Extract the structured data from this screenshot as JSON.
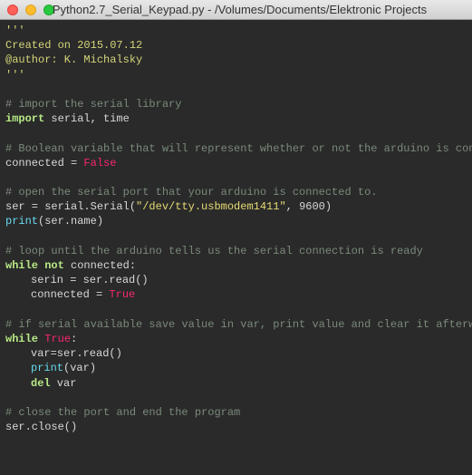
{
  "window": {
    "title": "Python2.7_Serial_Keypad.py - /Volumes/Documents/Elektronic Projects"
  },
  "code": {
    "docstring_open": "'''",
    "docstring_line1": "Created on 2015.07.12",
    "docstring_blank": "",
    "docstring_line2": "@author: K. Michalsky",
    "docstring_close": "'''",
    "comment_import": "# import the serial library",
    "kw_import": "import",
    "import_modules": " serial, time",
    "comment_bool": "# Boolean variable that will represent whether or not the arduino is connected",
    "var_connected": "connected ",
    "op_eq": "= ",
    "const_false": "False",
    "comment_open": "# open the serial port that your arduino is connected to.",
    "ser_assign": "ser = serial.Serial(",
    "ser_string": "\"/dev/tty.usbmodem1411\"",
    "ser_rest": ", 9600)",
    "fn_print": "print",
    "print_arg1": "(ser.name)",
    "comment_loop": "# loop until the arduino tells us the serial connection is ready",
    "kw_while": "while",
    "kw_not": " not ",
    "while_cond": "connected:",
    "serin_line": "serin = ser.read()",
    "connected_assign": "connected ",
    "const_true": "True",
    "comment_serial": "# if serial available save value in var, print value and clear it afterwards for new input",
    "while_true_cond": ":",
    "var_line": "var=ser.read()",
    "print_arg2": "(var)",
    "kw_del": "del",
    "del_arg": " var",
    "comment_close": "# close the port and end the program",
    "close_line": "ser.close()"
  }
}
